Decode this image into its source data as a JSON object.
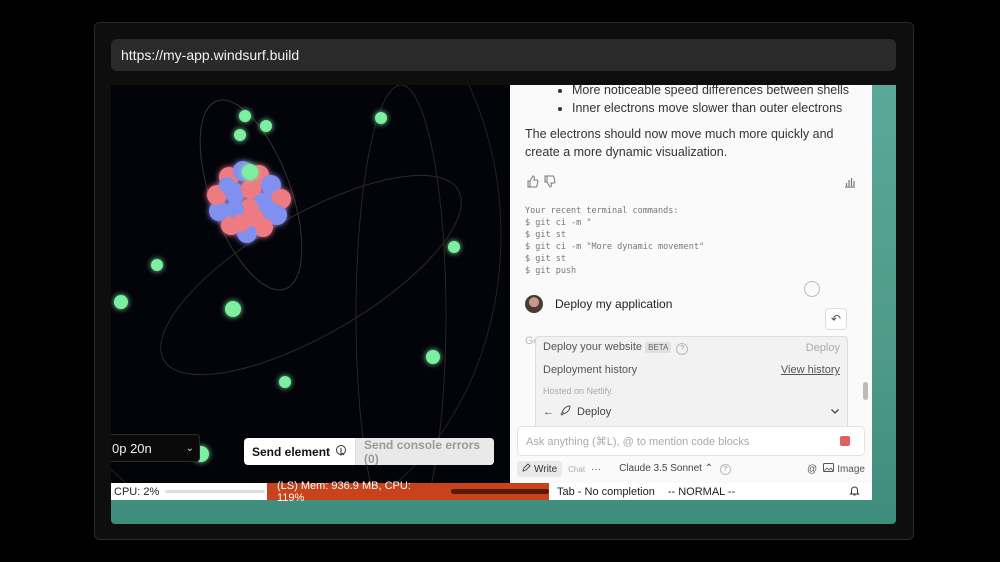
{
  "browser": {
    "url": "https://my-app.windsurf.build"
  },
  "preview": {
    "speed_value": "0p 20n",
    "send_element_label": "Send element",
    "send_console_errors_label": "Send console errors (0)"
  },
  "chat": {
    "bullets": [
      "More noticeable speed differences between shells",
      "Inner electrons move slower than outer electrons"
    ],
    "answer": "The electrons should now move much more quickly and create a more dynamic visualization.",
    "terminal_heading": "Your recent terminal commands:",
    "terminal_commands": [
      "$ git ci -m \"",
      "$ git st",
      "$ git ci -m \"More dynamic movement\"",
      "$ git st",
      "$ git push"
    ],
    "user_message": "Deploy my application",
    "ghost_text": "Ge",
    "popup": {
      "deploy_website_label": "Deploy your website",
      "beta_badge": "BETA",
      "deploy_action": "Deploy",
      "history_label": "Deployment history",
      "history_link": "View history",
      "hosted_note": "Hosted on Netlify.",
      "deploy_button": "Deploy"
    },
    "input_placeholder": "Ask anything (⌘L), @ to mention code blocks",
    "write_tab": "Write",
    "chat_tab": "Chat",
    "more": "···",
    "model": "Claude 3.5 Sonnet",
    "image_label": "Image"
  },
  "statusbar": {
    "cpu": "CPU: 2%",
    "ls": "(LS) Mem: 936.9 MB, CPU: 119%",
    "tab": "Tab - No completion",
    "mode": "-- NORMAL --"
  },
  "colors": {
    "electron": "#7cf0a0",
    "proton": "#ee7a82",
    "neutron": "#8090ee",
    "status_alert": "#c8421c",
    "viewport_bg": "#4f9a89"
  }
}
